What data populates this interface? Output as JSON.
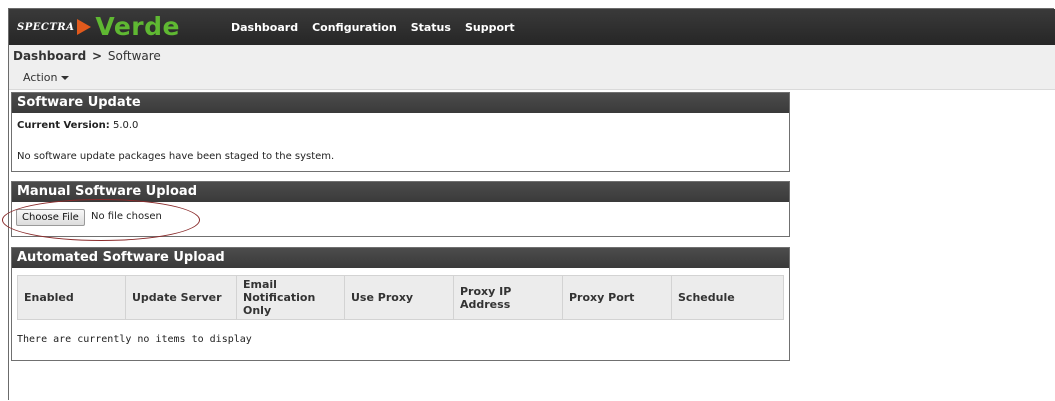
{
  "brand": {
    "spectra": "SPECTRA",
    "verde": "Verde"
  },
  "nav": [
    "Dashboard",
    "Configuration",
    "Status",
    "Support"
  ],
  "breadcrumb": {
    "parent": "Dashboard",
    "separator": ">",
    "current": "Software"
  },
  "action_menu": {
    "label": "Action"
  },
  "software_update": {
    "title": "Software Update",
    "current_version_label": "Current Version:",
    "current_version": "5.0.0",
    "message": "No software update packages have been staged to the system."
  },
  "manual_upload": {
    "title": "Manual Software Upload",
    "choose_file_label": "Choose File",
    "file_status": "No file chosen"
  },
  "automated_upload": {
    "title": "Automated Software Upload",
    "columns": [
      "Enabled",
      "Update Server",
      "Email Notification Only",
      "Use Proxy",
      "Proxy IP Address",
      "Proxy Port",
      "Schedule"
    ],
    "empty_message": "There are currently no items to display"
  },
  "colors": {
    "accent_green": "#5fb832",
    "accent_orange": "#e25a1c",
    "header_dark": "#3a3a3a",
    "highlight_ring": "#8a2b2b"
  }
}
